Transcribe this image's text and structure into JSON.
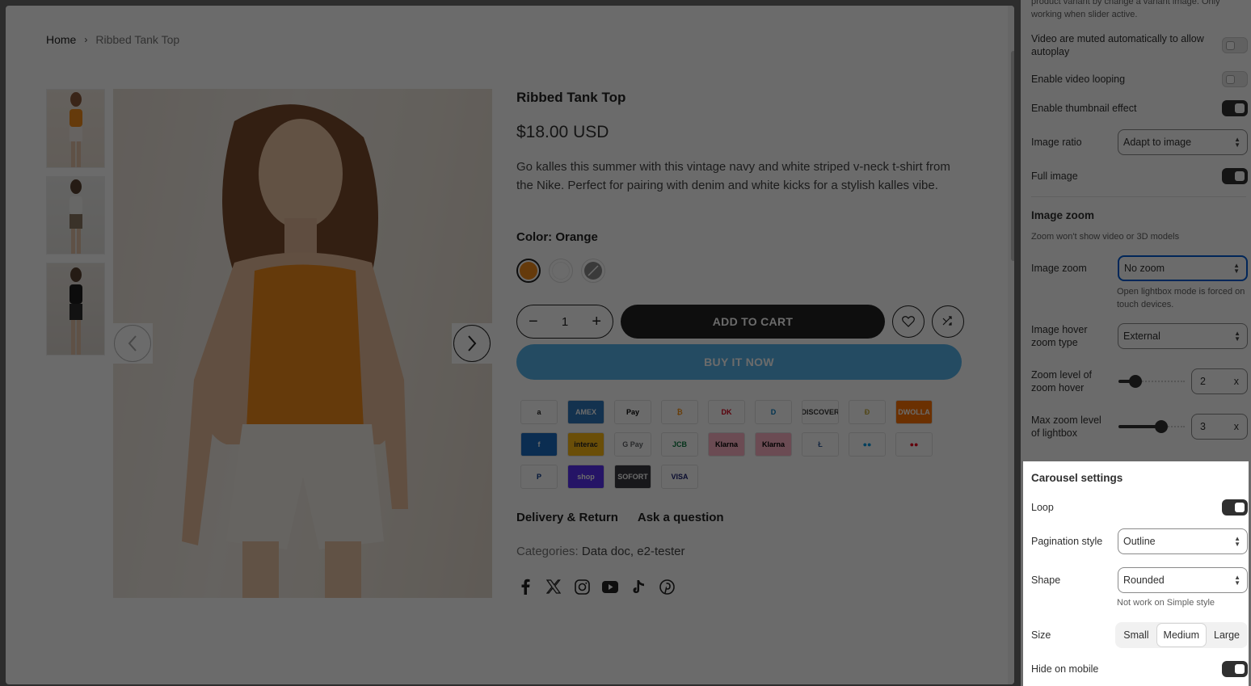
{
  "breadcrumb": {
    "home": "Home",
    "sep": "›",
    "current": "Ribbed Tank Top"
  },
  "product": {
    "title": "Ribbed Tank Top",
    "price": "$18.00 USD",
    "description": "Go kalles this summer with this vintage navy and white striped v-neck t-shirt from the Nike. Perfect for pairing with denim and white kicks for a stylish kalles vibe.",
    "color_label": "Color: Orange",
    "swatches": [
      "#f08a1c",
      "#ffffff",
      "#8a8a8a"
    ],
    "quantity": "1",
    "minus": "−",
    "plus": "+",
    "add_to_cart": "ADD TO CART",
    "buy_now": "BUY IT NOW",
    "tabs": [
      "Delivery & Return",
      "Ask a question"
    ],
    "categories_key": "Categories:",
    "categories_value": "Data doc, e2-tester"
  },
  "payments": [
    {
      "label": "a",
      "bg": "#ffffff",
      "fg": "#222"
    },
    {
      "label": "AMEX",
      "bg": "#2e77bc",
      "fg": "#fff"
    },
    {
      "label": "Pay",
      "bg": "#ffffff",
      "fg": "#000"
    },
    {
      "label": "₿",
      "bg": "#ffffff",
      "fg": "#f7931a"
    },
    {
      "label": "DK",
      "bg": "#ffffff",
      "fg": "#d6001c"
    },
    {
      "label": "D",
      "bg": "#ffffff",
      "fg": "#0079be"
    },
    {
      "label": "DISCOVER",
      "bg": "#ffffff",
      "fg": "#333"
    },
    {
      "label": "Ð",
      "bg": "#ffffff",
      "fg": "#c2a633"
    },
    {
      "label": "DWOLLA",
      "bg": "#ff7404",
      "fg": "#fff"
    },
    {
      "label": "f",
      "bg": "#1b6dc1",
      "fg": "#fff"
    },
    {
      "label": "interac",
      "bg": "#fdb913",
      "fg": "#222"
    },
    {
      "label": "G Pay",
      "bg": "#ffffff",
      "fg": "#5f6368"
    },
    {
      "label": "JCB",
      "bg": "#ffffff",
      "fg": "#0b7a3e"
    },
    {
      "label": "Klarna",
      "bg": "#ffb3c7",
      "fg": "#000"
    },
    {
      "label": "Klarna",
      "bg": "#ffb3c7",
      "fg": "#000"
    },
    {
      "label": "Ł",
      "bg": "#ffffff",
      "fg": "#345d9d"
    },
    {
      "label": "●●",
      "bg": "#ffffff",
      "fg": "#0099df"
    },
    {
      "label": "●●",
      "bg": "#ffffff",
      "fg": "#eb001b"
    },
    {
      "label": "P",
      "bg": "#ffffff",
      "fg": "#003087"
    },
    {
      "label": "shop",
      "bg": "#5a31f4",
      "fg": "#fff"
    },
    {
      "label": "SOFORT",
      "bg": "#393a41",
      "fg": "#fff"
    },
    {
      "label": "VISA",
      "bg": "#ffffff",
      "fg": "#1a1f71"
    }
  ],
  "socials": [
    "facebook-icon",
    "x-icon",
    "instagram-icon",
    "youtube-icon",
    "tiktok-icon",
    "pinterest-icon"
  ],
  "panel": {
    "top_hint": "product variant by change a variant image. Only working when slider active.",
    "video_muted": "Video are muted automatically to allow autoplay",
    "video_looping": "Enable video looping",
    "thumbnail_effect": "Enable thumbnail effect",
    "image_ratio_label": "Image ratio",
    "image_ratio_value": "Adapt to image",
    "full_image": "Full image",
    "image_zoom_title": "Image zoom",
    "image_zoom_hint": "Zoom won't show video or 3D models",
    "image_zoom_label": "Image zoom",
    "image_zoom_value": "No zoom",
    "image_zoom_note": "Open lightbox mode is forced on touch devices.",
    "hover_zoom_type_label": "Image hover zoom type",
    "hover_zoom_type_value": "External",
    "zoom_level_label": "Zoom level of zoom hover",
    "zoom_level_value": "2",
    "max_zoom_label": "Max zoom level of lightbox",
    "max_zoom_value": "3",
    "unit": "x",
    "carousel_title": "Carousel settings",
    "loop": "Loop",
    "pagination_label": "Pagination style",
    "pagination_value": "Outline",
    "shape_label": "Shape",
    "shape_value": "Rounded",
    "shape_note": "Not work on Simple style",
    "size_label": "Size",
    "size_options": [
      "Small",
      "Medium",
      "Large"
    ],
    "hide_mobile": "Hide on mobile"
  }
}
